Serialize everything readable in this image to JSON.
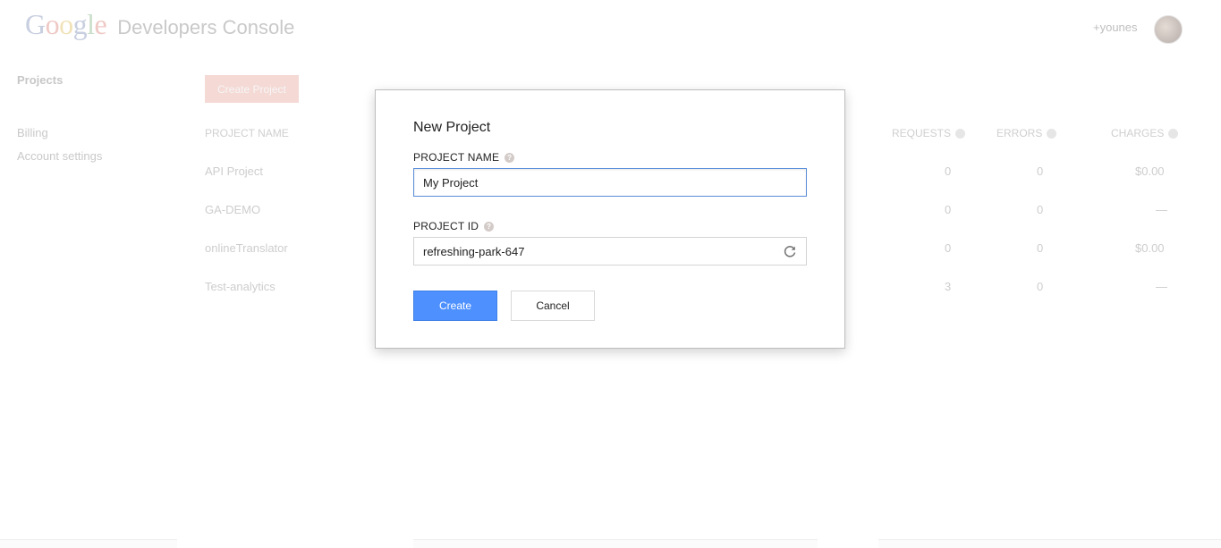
{
  "header": {
    "logo_google_letters": [
      "G",
      "o",
      "o",
      "g",
      "l",
      "e"
    ],
    "logo_product": "Developers Console",
    "user_name": "+younes"
  },
  "sidebar": {
    "items": [
      {
        "label": "Projects",
        "active": true
      },
      {
        "label": "Billing",
        "active": false
      },
      {
        "label": "Account settings",
        "active": false
      }
    ]
  },
  "toolbar": {
    "create_project_label": "Create Project"
  },
  "table": {
    "columns": [
      "PROJECT NAME",
      "REQUESTS",
      "ERRORS",
      "CHARGES"
    ],
    "rows": [
      {
        "name": "API Project",
        "requests": "0",
        "errors": "0",
        "charges": "$0.00"
      },
      {
        "name": "GA-DEMO",
        "requests": "0",
        "errors": "0",
        "charges": "—"
      },
      {
        "name": "onlineTranslator",
        "requests": "0",
        "errors": "0",
        "charges": "$0.00"
      },
      {
        "name": "Test-analytics",
        "requests": "3",
        "errors": "0",
        "charges": "—"
      }
    ]
  },
  "dialog": {
    "title": "New Project",
    "project_name_label": "PROJECT NAME",
    "project_name_value": "My Project",
    "project_id_label": "PROJECT ID",
    "project_id_value": "refreshing-park-647",
    "create_label": "Create",
    "cancel_label": "Cancel"
  },
  "colors": {
    "primary_button": "#4d90fe",
    "input_focus_border": "#5b8fd9"
  }
}
